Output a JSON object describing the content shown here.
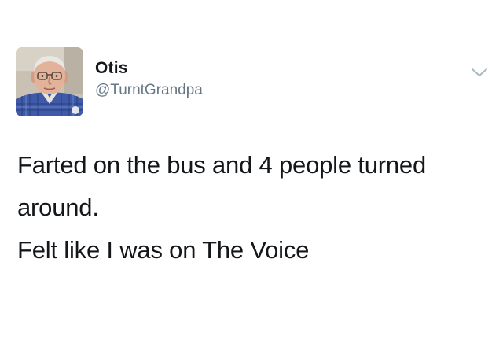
{
  "tweet": {
    "user": {
      "display_name": "Otis",
      "handle": "@TurntGrandpa",
      "avatar_icon": "elderly-man-avatar"
    },
    "menu_icon": "chevron-down-icon",
    "text_lines": [
      "Farted on the bus and 4 people turned",
      "around.",
      "Felt like I was on The Voice"
    ]
  },
  "colors": {
    "text": "#14171a",
    "handle": "#657786",
    "chevron": "#aab8c2",
    "background": "#ffffff"
  }
}
